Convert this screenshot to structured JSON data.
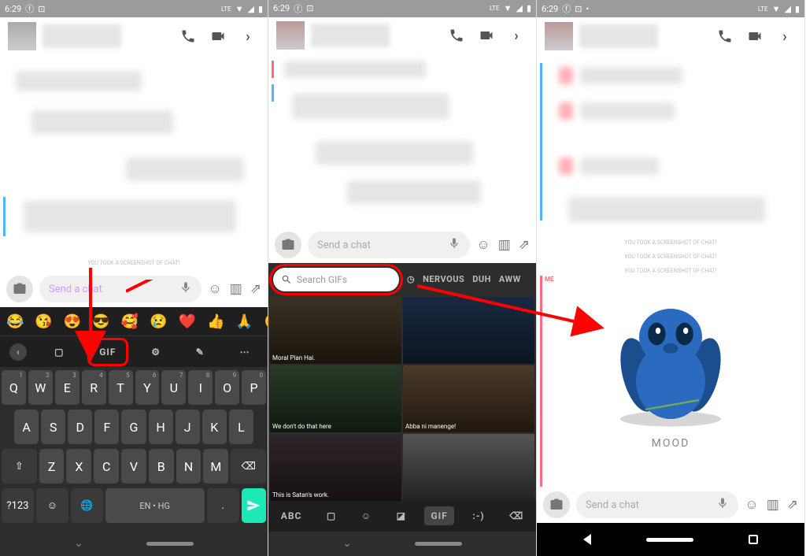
{
  "status": {
    "time": "6:29",
    "network": "LTE"
  },
  "chat": {
    "placeholder_p1": "Send a chat",
    "placeholder_p2": "Send a chat",
    "placeholder_p3": "Send a chat",
    "screenshot_notice": "YOU TOOK A SCREENSHOT OF CHAT!"
  },
  "keyboard": {
    "row1": [
      "Q",
      "W",
      "E",
      "R",
      "T",
      "Y",
      "U",
      "I",
      "O",
      "P"
    ],
    "row1_sup": [
      "1",
      "2",
      "3",
      "4",
      "5",
      "6",
      "7",
      "8",
      "9",
      "0"
    ],
    "row2": [
      "A",
      "S",
      "D",
      "F",
      "G",
      "H",
      "J",
      "K",
      "L"
    ],
    "row3": [
      "Z",
      "X",
      "C",
      "V",
      "B",
      "N",
      "M"
    ],
    "numkey": "?123",
    "lang": "EN • HG",
    "gif_label": "GIF",
    "emoji_bar": [
      "😂",
      "😘",
      "😍",
      "😎",
      "🥰",
      "😢",
      "❤️",
      "👍",
      "🙏",
      "☺️"
    ]
  },
  "gif_panel": {
    "search_placeholder": "Search GIFs",
    "categories": [
      "NERVOUS",
      "DUH",
      "AWW"
    ],
    "recent_icon": "◷",
    "captions": [
      "Moral Plan Hai.",
      "",
      "We don't do that here",
      "Abba ni manenge!",
      "This is Satan's work.",
      ""
    ],
    "toolbar": {
      "abc": "ABC",
      "gif": "GIF",
      "emote": ":-)"
    }
  },
  "result": {
    "mood": "MOOD",
    "me_label": "ME"
  }
}
